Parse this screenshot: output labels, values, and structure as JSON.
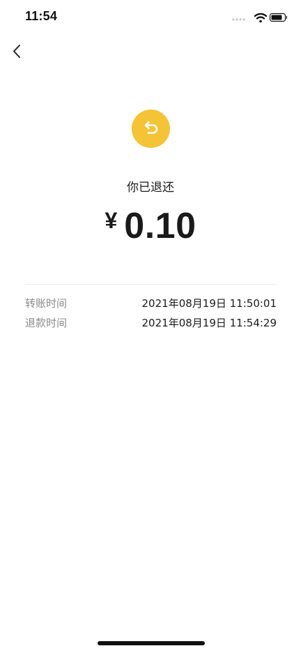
{
  "status_bar": {
    "time": "11:54",
    "icons": [
      "signal-icon",
      "wifi-icon",
      "battery-icon"
    ]
  },
  "nav": {
    "back_icon": "chevron-left-icon"
  },
  "refund": {
    "icon": "refund-arrow-icon",
    "icon_color": "#f4c336",
    "status_text": "你已退还",
    "currency": "¥",
    "amount": "0.10"
  },
  "details": [
    {
      "label": "转账时间",
      "value": "2021年08月19日 11:50:01"
    },
    {
      "label": "退款时间",
      "value": "2021年08月19日 11:54:29"
    }
  ]
}
